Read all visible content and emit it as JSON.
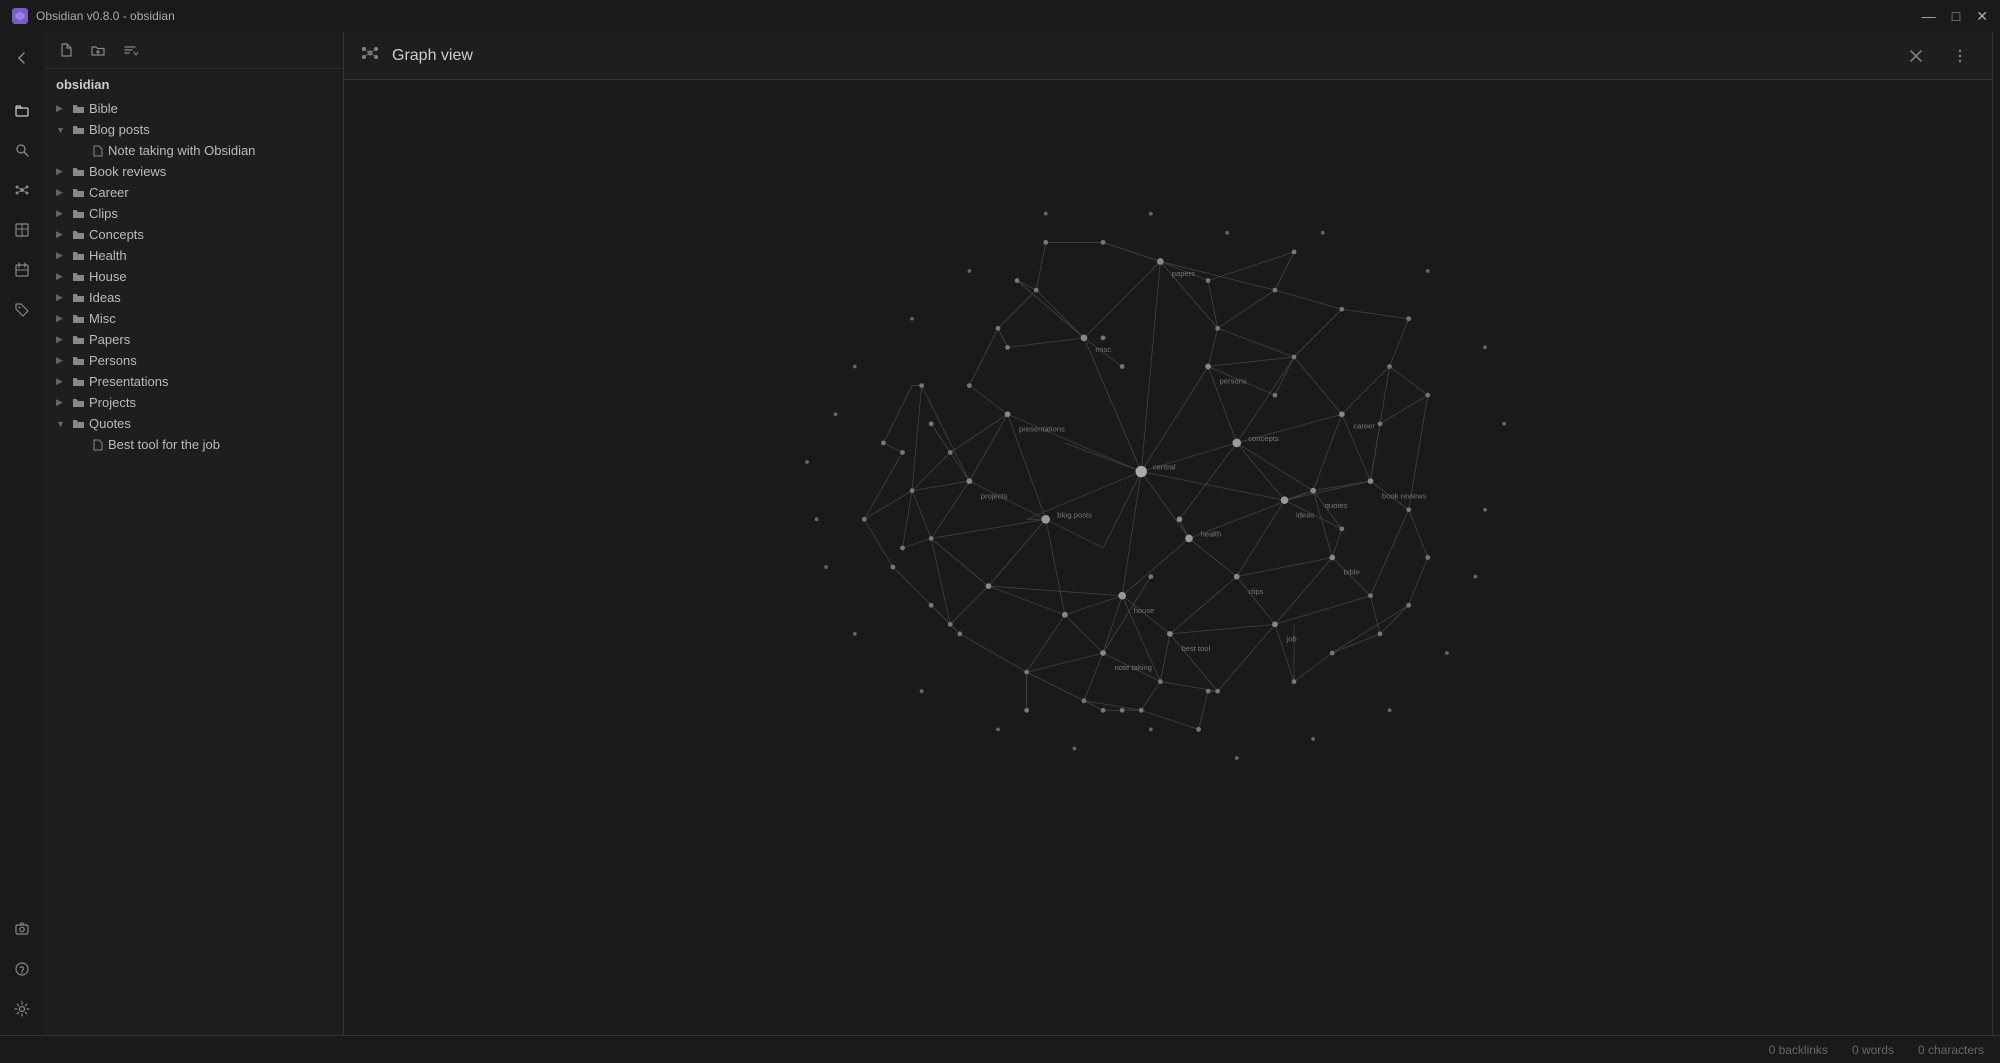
{
  "titlebar": {
    "title": "Obsidian v0.8.0 - obsidian",
    "icon": "⬡",
    "controls": {
      "minimize": "—",
      "maximize": "□",
      "close": "✕"
    }
  },
  "sidebar_icons": {
    "items": [
      {
        "name": "back-icon",
        "icon": "‹",
        "label": "Back"
      },
      {
        "name": "file-explorer-icon",
        "icon": "📁",
        "label": "File explorer"
      },
      {
        "name": "search-icon",
        "icon": "🔍",
        "label": "Search"
      },
      {
        "name": "graph-view-icon",
        "icon": "⬡",
        "label": "Graph view"
      },
      {
        "name": "table-icon",
        "icon": "⊞",
        "label": "Table"
      },
      {
        "name": "calendar-icon",
        "icon": "📅",
        "label": "Calendar"
      },
      {
        "name": "tag-icon",
        "icon": "🏷",
        "label": "Tags"
      },
      {
        "name": "camera-icon",
        "icon": "📷",
        "label": "Snapshots"
      },
      {
        "name": "help-icon",
        "icon": "?",
        "label": "Help"
      },
      {
        "name": "settings-icon",
        "icon": "⚙",
        "label": "Settings"
      }
    ]
  },
  "file_panel": {
    "root_label": "obsidian",
    "toolbar": {
      "new_file": "📄",
      "new_folder": "📁",
      "sort": "↕"
    },
    "tree": [
      {
        "id": "bible",
        "label": "Bible",
        "type": "folder",
        "collapsed": true,
        "depth": 0
      },
      {
        "id": "blog-posts",
        "label": "Blog posts",
        "type": "folder",
        "collapsed": false,
        "depth": 0
      },
      {
        "id": "note-taking",
        "label": "Note taking with Obsidian",
        "type": "file",
        "depth": 1
      },
      {
        "id": "book-reviews",
        "label": "Book reviews",
        "type": "folder",
        "collapsed": true,
        "depth": 0
      },
      {
        "id": "career",
        "label": "Career",
        "type": "folder",
        "collapsed": true,
        "depth": 0
      },
      {
        "id": "clips",
        "label": "Clips",
        "type": "folder",
        "collapsed": true,
        "depth": 0
      },
      {
        "id": "concepts",
        "label": "Concepts",
        "type": "folder",
        "collapsed": true,
        "depth": 0
      },
      {
        "id": "health",
        "label": "Health",
        "type": "folder",
        "collapsed": true,
        "depth": 0
      },
      {
        "id": "house",
        "label": "House",
        "type": "folder",
        "collapsed": true,
        "depth": 0
      },
      {
        "id": "ideas",
        "label": "Ideas",
        "type": "folder",
        "collapsed": true,
        "depth": 0
      },
      {
        "id": "misc",
        "label": "Misc",
        "type": "folder",
        "collapsed": true,
        "depth": 0
      },
      {
        "id": "papers",
        "label": "Papers",
        "type": "folder",
        "collapsed": true,
        "depth": 0
      },
      {
        "id": "persons",
        "label": "Persons",
        "type": "folder",
        "collapsed": true,
        "depth": 0
      },
      {
        "id": "presentations",
        "label": "Presentations",
        "type": "folder",
        "collapsed": true,
        "depth": 0
      },
      {
        "id": "projects",
        "label": "Projects",
        "type": "folder",
        "collapsed": true,
        "depth": 0
      },
      {
        "id": "quotes",
        "label": "Quotes",
        "type": "folder",
        "collapsed": false,
        "depth": 0
      },
      {
        "id": "best-tool",
        "label": "Best tool for the job",
        "type": "file",
        "depth": 1
      }
    ]
  },
  "graph_view": {
    "title": "Graph view",
    "header_icon": "⬡",
    "close_label": "✕",
    "more_options": "⋮"
  },
  "status_bar": {
    "backlinks": "0 backlinks",
    "words": "0 words",
    "characters": "0 characters"
  }
}
